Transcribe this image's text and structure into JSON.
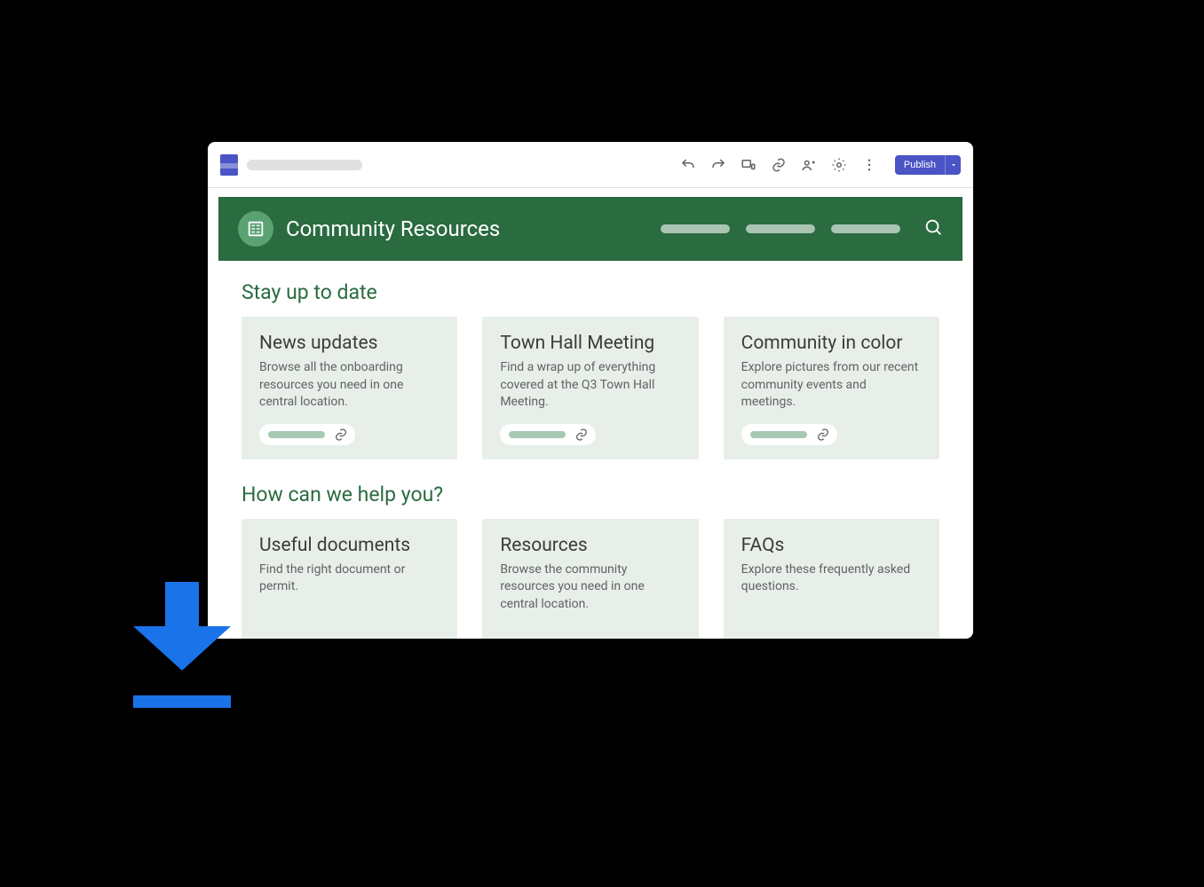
{
  "toolbar": {
    "publish_label": "Publish"
  },
  "site": {
    "title": "Community Resources"
  },
  "sections": [
    {
      "title": "Stay up to date",
      "cards": [
        {
          "title": "News updates",
          "desc": "Browse all the onboarding resources you need in one central location."
        },
        {
          "title": "Town Hall Meeting",
          "desc": "Find a wrap up of everything covered at the Q3 Town Hall Meeting."
        },
        {
          "title": "Community in color",
          "desc": "Explore pictures from our recent community events and meetings."
        }
      ]
    },
    {
      "title": "How can we help you?",
      "cards": [
        {
          "title": "Useful documents",
          "desc": "Find the right document or permit."
        },
        {
          "title": "Resources",
          "desc": "Browse the community resources you need in one central location."
        },
        {
          "title": "FAQs",
          "desc": "Explore these frequently asked questions."
        }
      ]
    }
  ]
}
